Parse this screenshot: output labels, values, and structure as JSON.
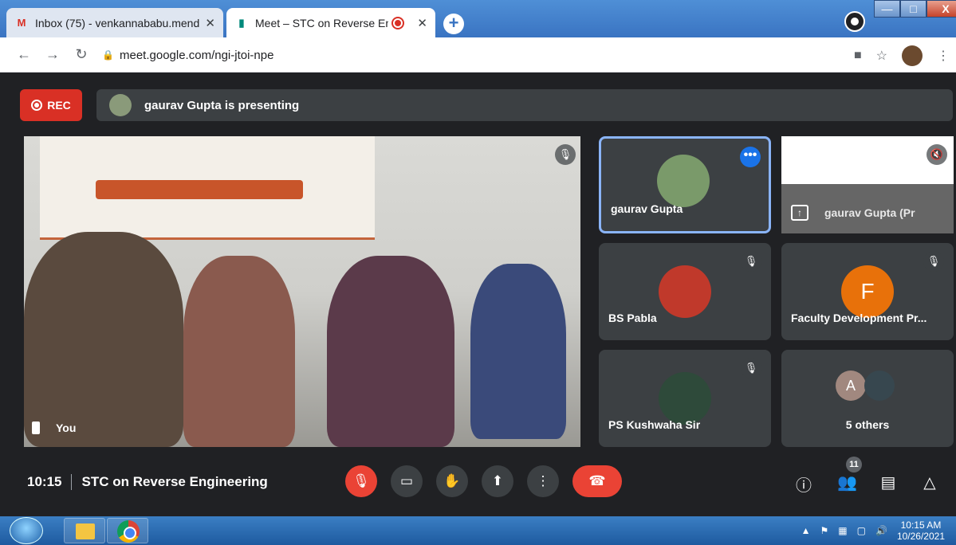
{
  "browser": {
    "tabs": [
      {
        "title": "Inbox (75) - venkannababu.mend",
        "favicon": "gmail-icon"
      },
      {
        "title": "Meet – STC on Reverse Engir",
        "favicon": "meet-icon"
      }
    ],
    "url": "meet.google.com/ngi-jtoi-npe",
    "window_buttons": {
      "minimize": "—",
      "maximize": "□",
      "close": "X"
    }
  },
  "meet": {
    "rec_label": "REC",
    "presenting_text": "gaurav Gupta is presenting",
    "main_tile": {
      "label": "You"
    },
    "participants": [
      {
        "name": "gaurav Gupta",
        "selected": true
      },
      {
        "name": "gaurav Gupta (Pr",
        "presentation": true
      },
      {
        "name": "BS Pabla"
      },
      {
        "name": "Faculty Development Pr...",
        "initial": "F"
      },
      {
        "name": "PS Kushwaha Sir"
      },
      {
        "name": "5 others",
        "initial": "A"
      }
    ],
    "time": "10:15",
    "meeting_title": "STC on Reverse Engineering",
    "people_count": "11"
  },
  "taskbar": {
    "time": "10:15 AM",
    "date": "10/26/2021"
  },
  "colors": {
    "accent": "#1a73e8",
    "danger": "#ea4335",
    "bg": "#202124",
    "tile": "#3c4043"
  }
}
